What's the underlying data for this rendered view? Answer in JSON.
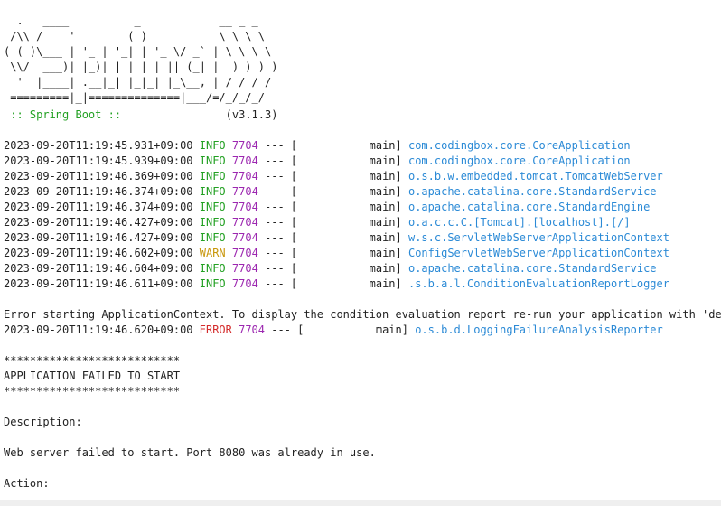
{
  "banner": {
    "lines": [
      "  .   ____          _            __ _ _",
      " /\\\\ / ___'_ __ _ _(_)_ __  __ _ \\ \\ \\ \\",
      "( ( )\\___ | '_ | '_| | '_ \\/ _` | \\ \\ \\ \\",
      " \\\\/  ___)| |_)| | | | | || (_| |  ) ) ) )",
      "  '  |____| .__|_| |_|_| |_\\__, | / / / /",
      " =========|_|==============|___/=/_/_/_/"
    ],
    "spring_label": " :: Spring Boot ::",
    "version": "                (v3.1.3)"
  },
  "log_lines": [
    {
      "ts": "2023-09-20T11:19:45.931+09:00",
      "level": "INFO",
      "pid": "7704",
      "sep": " --- [",
      "thread": "           main]",
      "logger": "com.codingbox.core.CoreApplication"
    },
    {
      "ts": "2023-09-20T11:19:45.939+09:00",
      "level": "INFO",
      "pid": "7704",
      "sep": " --- [",
      "thread": "           main]",
      "logger": "com.codingbox.core.CoreApplication"
    },
    {
      "ts": "2023-09-20T11:19:46.369+09:00",
      "level": "INFO",
      "pid": "7704",
      "sep": " --- [",
      "thread": "           main]",
      "logger": "o.s.b.w.embedded.tomcat.TomcatWebServer"
    },
    {
      "ts": "2023-09-20T11:19:46.374+09:00",
      "level": "INFO",
      "pid": "7704",
      "sep": " --- [",
      "thread": "           main]",
      "logger": "o.apache.catalina.core.StandardService"
    },
    {
      "ts": "2023-09-20T11:19:46.374+09:00",
      "level": "INFO",
      "pid": "7704",
      "sep": " --- [",
      "thread": "           main]",
      "logger": "o.apache.catalina.core.StandardEngine"
    },
    {
      "ts": "2023-09-20T11:19:46.427+09:00",
      "level": "INFO",
      "pid": "7704",
      "sep": " --- [",
      "thread": "           main]",
      "logger": "o.a.c.c.C.[Tomcat].[localhost].[/]"
    },
    {
      "ts": "2023-09-20T11:19:46.427+09:00",
      "level": "INFO",
      "pid": "7704",
      "sep": " --- [",
      "thread": "           main]",
      "logger": "w.s.c.ServletWebServerApplicationContext"
    },
    {
      "ts": "2023-09-20T11:19:46.602+09:00",
      "level": "WARN",
      "pid": "7704",
      "sep": " --- [",
      "thread": "           main]",
      "logger": "ConfigServletWebServerApplicationContext"
    },
    {
      "ts": "2023-09-20T11:19:46.604+09:00",
      "level": "INFO",
      "pid": "7704",
      "sep": " --- [",
      "thread": "           main]",
      "logger": "o.apache.catalina.core.StandardService"
    },
    {
      "ts": "2023-09-20T11:19:46.611+09:00",
      "level": "INFO",
      "pid": "7704",
      "sep": " --- [",
      "thread": "           main]",
      "logger": ".s.b.a.l.ConditionEvaluationReportLogger"
    }
  ],
  "error_hint": "Error starting ApplicationContext. To display the condition evaluation report re-run your application with 'debug' enabled.",
  "error_line": {
    "ts": "2023-09-20T11:19:46.620+09:00",
    "level": "ERROR",
    "pid": "7704",
    "sep": " --- [",
    "thread": "           main]",
    "logger": "o.s.b.d.LoggingFailureAnalysisReporter"
  },
  "stars": "***************************",
  "failed_title": "APPLICATION FAILED TO START",
  "description_label": "Description:",
  "description_text": "Web server failed to start. Port 8080 was already in use.",
  "action_label": "Action:",
  "colors": {
    "info": "#22a022",
    "warn": "#c8960a",
    "error": "#d42c2c",
    "pid": "#9c27b0",
    "logger": "#2b8ad6"
  }
}
